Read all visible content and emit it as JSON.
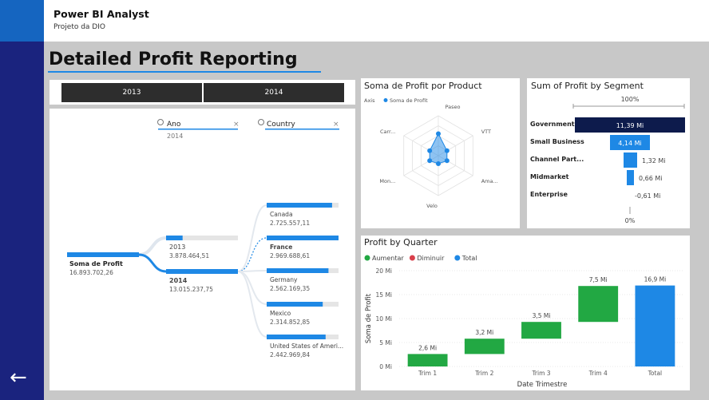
{
  "header": {
    "title": "Power BI Analyst",
    "subtitle": "Projeto da DIO"
  },
  "page_title": "Detailed Profit Reporting",
  "year_slicer": {
    "options": [
      "2013",
      "2014"
    ]
  },
  "decomp_tree": {
    "filters": [
      {
        "label": "Ano",
        "value": "2014"
      },
      {
        "label": "Country",
        "value": ""
      }
    ],
    "root": {
      "label": "Soma de Profit",
      "value": "16.893.702,26"
    },
    "years": [
      {
        "label": "2013",
        "value": "3.878.464,51",
        "fraction": 0.23
      },
      {
        "label": "2014",
        "value": "13.015.237,75",
        "fraction": 1.0
      }
    ],
    "countries": [
      {
        "label": "Canada",
        "value": "2.725.557,11",
        "fraction": 0.91
      },
      {
        "label": "France",
        "value": "2.969.688,61",
        "fraction": 1.0
      },
      {
        "label": "Germany",
        "value": "2.562.169,35",
        "fraction": 0.86
      },
      {
        "label": "Mexico",
        "value": "2.314.852,85",
        "fraction": 0.78
      },
      {
        "label": "United States of Ameri...",
        "value": "2.442.969,84",
        "fraction": 0.82
      }
    ]
  },
  "radar": {
    "title": "Soma de Profit por Product",
    "legend_axis": "Axis",
    "legend_series": "Soma de Profit",
    "axes": [
      "Paseo",
      "VTT",
      "Ama...",
      "Velo",
      "Mon...",
      "Carr..."
    ],
    "values": [
      0.55,
      0.25,
      0.25,
      0.2,
      0.25,
      0.25
    ]
  },
  "segment": {
    "title": "Sum of Profit by Segment",
    "top_axis": "100%",
    "bottom_axis": "0%",
    "rows": [
      {
        "label": "Government",
        "value_label": "11,39 Mi",
        "value": 11.39
      },
      {
        "label": "Small Business",
        "value_label": "4,14 Mi",
        "value": 4.14
      },
      {
        "label": "Channel Part...",
        "value_label": "1,32 Mi",
        "value": 1.32
      },
      {
        "label": "Midmarket",
        "value_label": "0,66 Mi",
        "value": 0.66
      },
      {
        "label": "Enterprise",
        "value_label": "-0,61 Mi",
        "value": -0.61
      }
    ]
  },
  "chart_data": {
    "type": "bar",
    "subtype": "waterfall",
    "title": "Profit by Quarter",
    "legend": [
      "Aumentar",
      "Diminuir",
      "Total"
    ],
    "colors": {
      "increase": "#22a843",
      "decrease": "#d9404b",
      "total": "#1e88e5"
    },
    "categories": [
      "Trim 1",
      "Trim 2",
      "Trim 3",
      "Trim 4",
      "Total"
    ],
    "values": [
      2.6,
      3.2,
      3.5,
      7.5,
      16.9
    ],
    "data_labels": [
      "2,6 Mi",
      "3,2 Mi",
      "3,5 Mi",
      "7,5 Mi",
      "16,9 Mi"
    ],
    "xlabel": "Date Trimestre",
    "ylabel": "Soma de Profit",
    "ylim": [
      0,
      20
    ],
    "yticks": [
      0,
      5,
      10,
      15,
      20
    ],
    "ytick_labels": [
      "0 Mi",
      "5 Mi",
      "10 Mi",
      "15 Mi",
      "20 Mi"
    ]
  }
}
